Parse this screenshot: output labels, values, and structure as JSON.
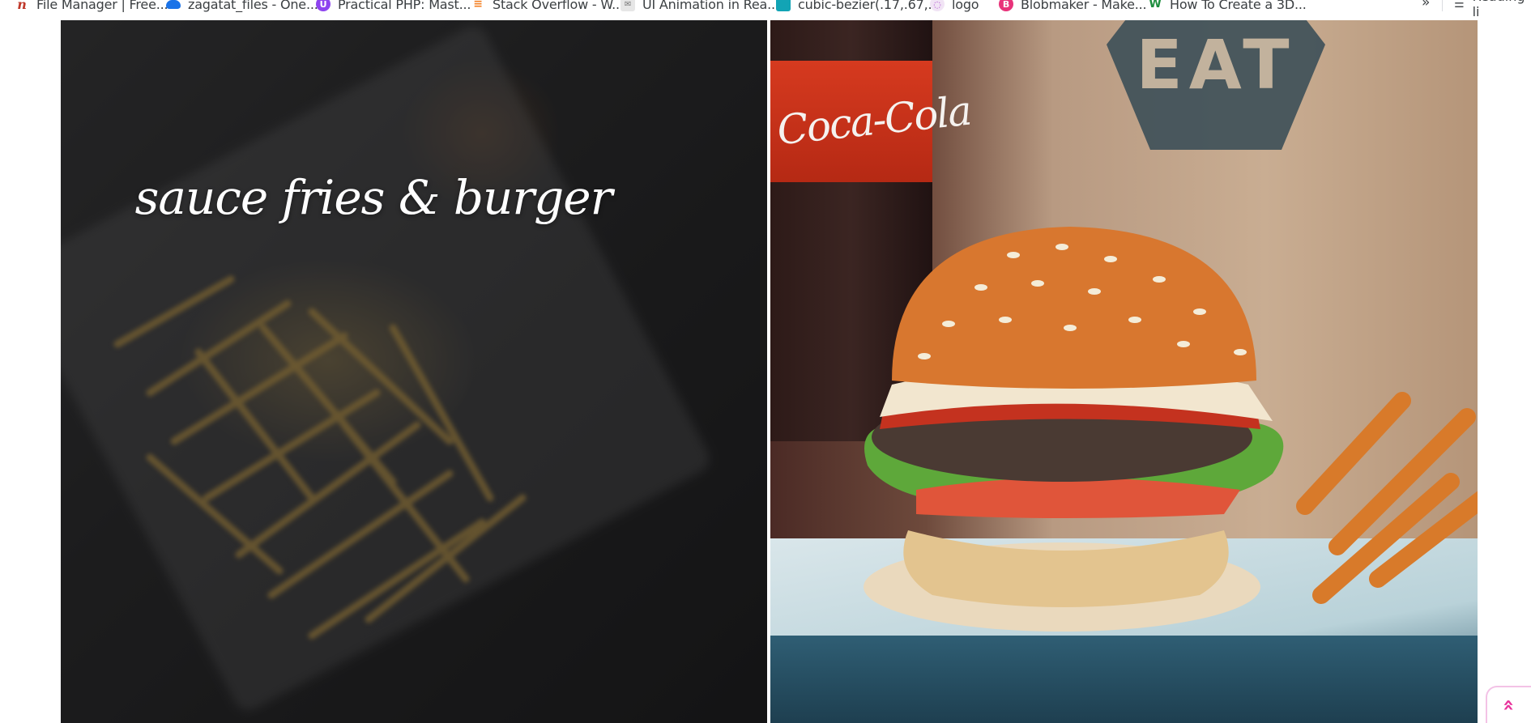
{
  "bookmarks": [
    {
      "label": "File Manager | Free...",
      "icon": "file-manager-icon"
    },
    {
      "label": "zagatat_files - One...",
      "icon": "onedrive-cloud-icon"
    },
    {
      "label": "Practical PHP: Mast...",
      "icon": "udemy-icon"
    },
    {
      "label": "Stack Overflow - W...",
      "icon": "stack-overflow-icon"
    },
    {
      "label": "UI Animation in Rea...",
      "icon": "envelope-icon"
    },
    {
      "label": "cubic-bezier(.17,.67,...",
      "icon": "cubic-bezier-icon"
    },
    {
      "label": "logo",
      "icon": "logo-icon"
    },
    {
      "label": "Blobmaker - Make...",
      "icon": "blobmaker-icon"
    },
    {
      "label": "How To Create a 3D...",
      "icon": "w-icon"
    }
  ],
  "more_bookmarks": "»",
  "reading_list": "Reading li",
  "hero": {
    "headline": "sauce fries & burger"
  },
  "images": {
    "bag_text": "EAT",
    "bottle_text": "Coca-Cola"
  },
  "scroll_top_icon": "double-chevron-up-icon",
  "colors": {
    "accent": "#e8339c"
  }
}
